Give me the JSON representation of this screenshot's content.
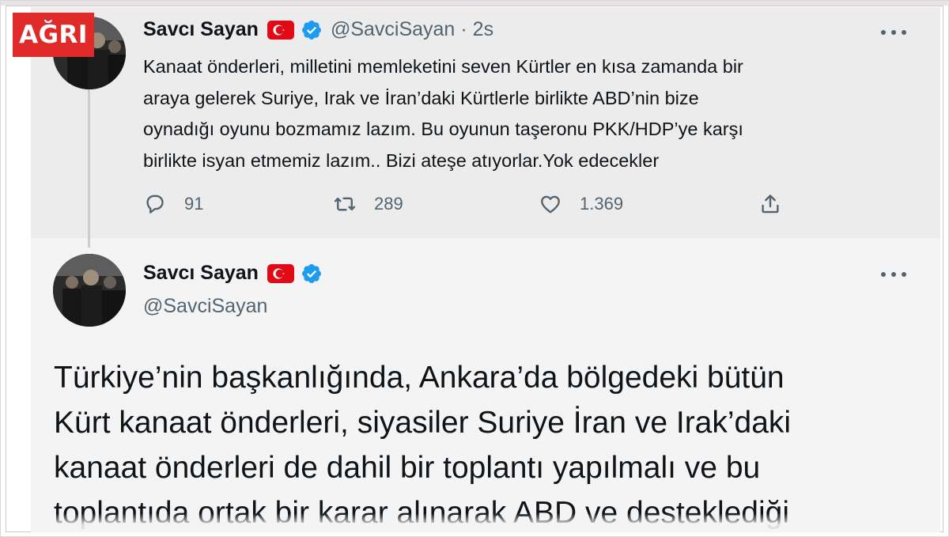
{
  "brand": {
    "label": "AĞRI",
    "color": "#e02a2a"
  },
  "colors": {
    "verified": "#1d9bf0",
    "muted": "#536471",
    "flag": "#e30a17"
  },
  "reply_tweet": {
    "display_name": "Savcı Sayan",
    "handle": "@SavciSayan",
    "separator": "·",
    "time": "2s",
    "text": "Kanaat  önderleri, milletini memleketini seven Kürtler en kısa zamanda bir\naraya gelerek Suriye, Irak ve  İran’daki Kürtlerle birlikte ABD’nin bize\noynadığı oyunu bozmamız lazım. Bu oyunun taşeronu PKK/HDP’ye karşı\nbirlikte isyan etmemiz lazım.. Bizi ateşe atıyorlar.Yok edecekler",
    "stats": {
      "replies": "91",
      "retweets": "289",
      "likes": "1.369"
    }
  },
  "main_tweet": {
    "display_name": "Savcı Sayan",
    "handle": "@SavciSayan",
    "text": "Türkiye’nin başkanlığında, Ankara’da bölgedeki bütün\nKürt kanaat önderleri, siyasiler Suriye İran ve Irak’daki\nkanaat önderleri de dahil bir toplantı yapılmalı ve bu\ntoplantıda ortak bir karar alınarak ABD ve desteklediği"
  },
  "icons": [
    "reply-icon",
    "retweet-icon",
    "like-icon",
    "share-icon",
    "verified-badge-icon",
    "turkey-flag-icon",
    "more-icon"
  ]
}
